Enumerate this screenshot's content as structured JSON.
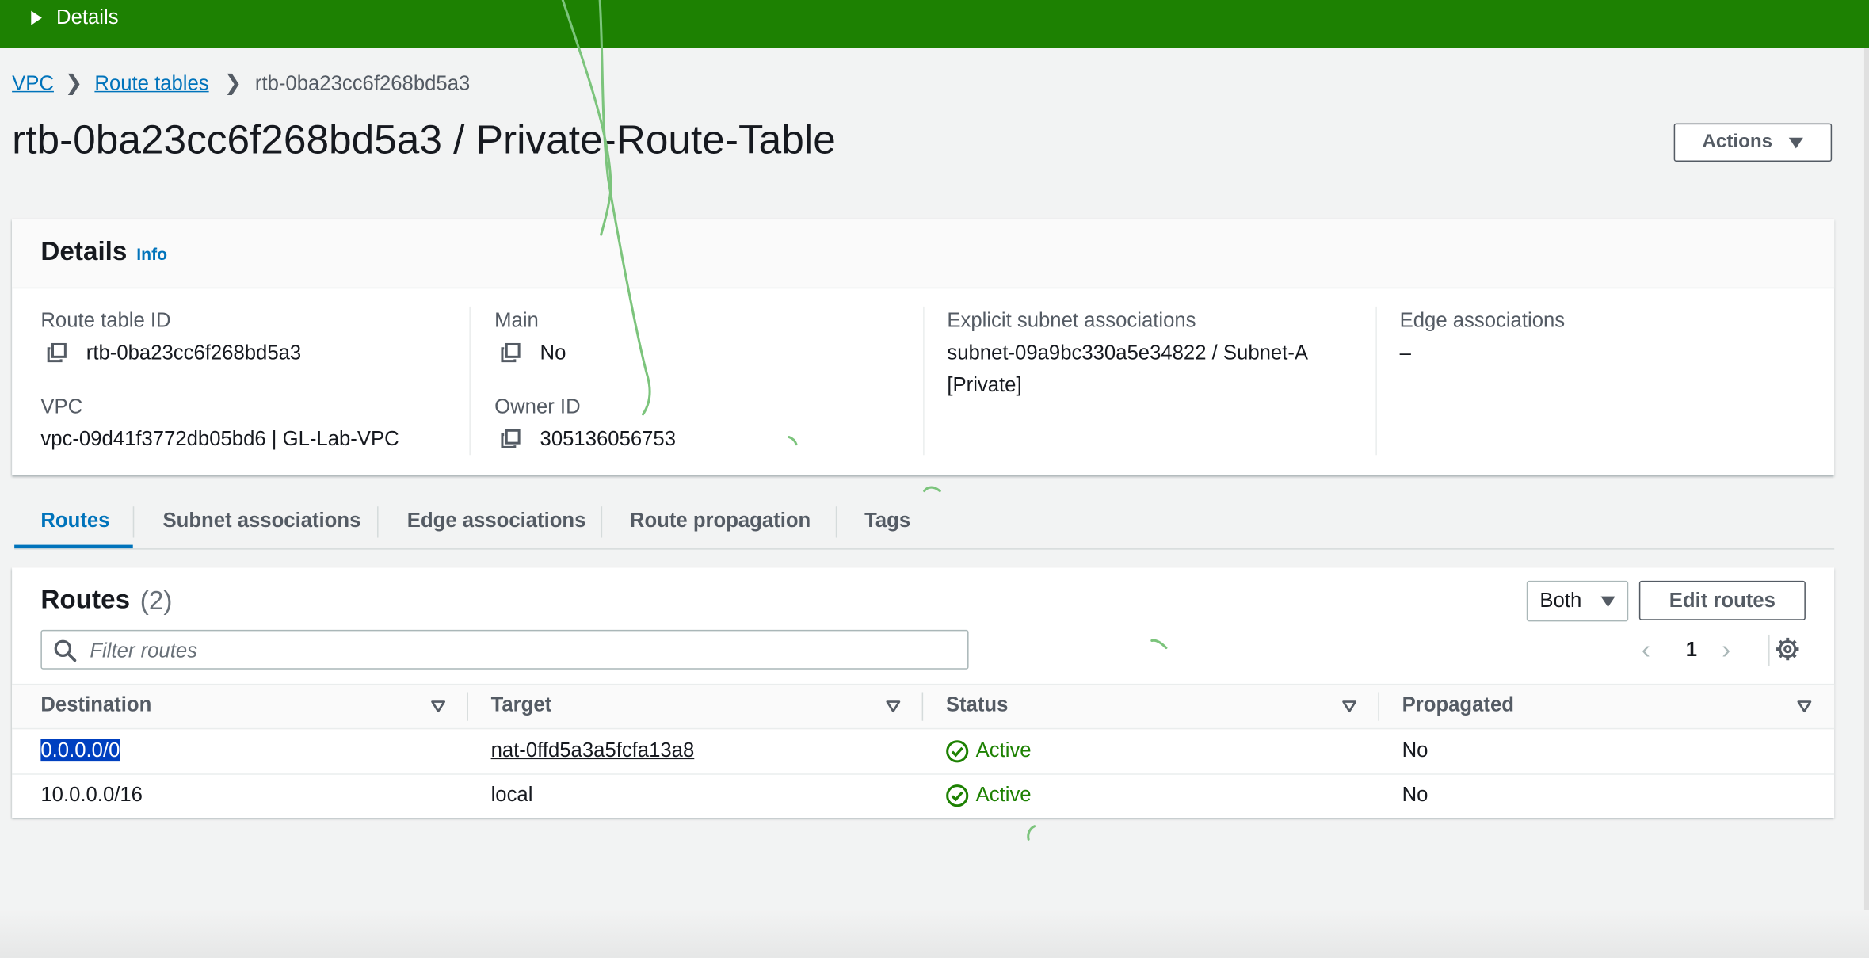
{
  "flashbar": {
    "label": "Details"
  },
  "breadcrumb": {
    "vpc": "VPC",
    "route_tables": "Route tables",
    "current": "rtb-0ba23cc6f268bd5a3"
  },
  "page": {
    "title": "rtb-0ba23cc6f268bd5a3 / Private-Route-Table",
    "actions_label": "Actions"
  },
  "details": {
    "title": "Details",
    "info": "Info",
    "route_table_id_label": "Route table ID",
    "route_table_id": "rtb-0ba23cc6f268bd5a3",
    "vpc_label": "VPC",
    "vpc": "vpc-09d41f3772db05bd6 | GL-Lab-VPC",
    "main_label": "Main",
    "main": "No",
    "owner_id_label": "Owner ID",
    "owner_id": "305136056753",
    "explicit_label": "Explicit subnet associations",
    "explicit_line1": "subnet-09a9bc330a5e34822 / Subnet-A",
    "explicit_line2": "[Private]",
    "edge_label": "Edge associations",
    "edge": "–"
  },
  "tabs": [
    "Routes",
    "Subnet associations",
    "Edge associations",
    "Route propagation",
    "Tags"
  ],
  "routes": {
    "title": "Routes",
    "count": "(2)",
    "filter_select": "Both",
    "edit_label": "Edit routes",
    "filter_placeholder": "Filter routes",
    "page": "1",
    "columns": [
      "Destination",
      "Target",
      "Status",
      "Propagated"
    ],
    "rows": [
      {
        "destination": "0.0.0.0/0",
        "target": "nat-0ffd5a3a5fcfa13a8",
        "status": "Active",
        "propagated": "No"
      },
      {
        "destination": "10.0.0.0/16",
        "target": "local",
        "status": "Active",
        "propagated": "No"
      }
    ]
  },
  "colors": {
    "flash": "#1d8102",
    "link": "#0073bb",
    "status_ok": "#1d8102"
  }
}
